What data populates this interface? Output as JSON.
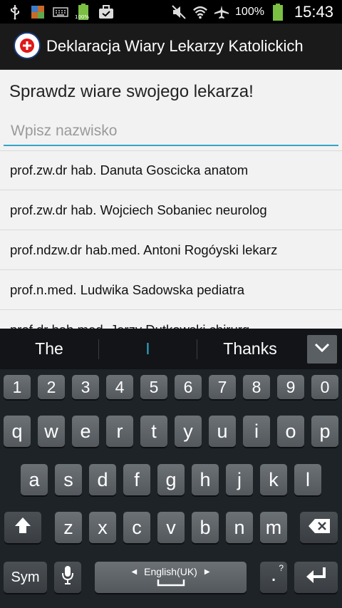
{
  "status_bar": {
    "left_icons": [
      "usb-icon",
      "image-icon",
      "keyboard-icon",
      "battery-full-icon",
      "briefcase-icon"
    ],
    "battery_badge": "100%",
    "battery_percent": "100%",
    "time": "15:43"
  },
  "app": {
    "title": "Deklaracja Wiary Lekarzy Katolickich"
  },
  "main": {
    "heading": "Sprawdz wiare swojego lekarza!",
    "search_placeholder": "Wpisz nazwisko",
    "search_value": "",
    "results": [
      "prof.zw.dr hab. Danuta Goscicka anatom",
      "prof.zw.dr hab. Wojciech Sobaniec neurolog",
      "prof.ndzw.dr hab.med. Antoni Rogóyski lekarz",
      "prof.n.med. Ludwika Sadowska pediatra",
      "prof.dr hab.med. Jerzy Dutkowski chirurg"
    ]
  },
  "keyboard": {
    "suggestions": [
      "The",
      "I",
      "Thanks"
    ],
    "number_row": [
      "1",
      "2",
      "3",
      "4",
      "5",
      "6",
      "7",
      "8",
      "9",
      "0"
    ],
    "row1": [
      "q",
      "w",
      "e",
      "r",
      "t",
      "y",
      "u",
      "i",
      "o",
      "p"
    ],
    "row2": [
      "a",
      "s",
      "d",
      "f",
      "g",
      "h",
      "j",
      "k",
      "l"
    ],
    "row3": [
      "z",
      "x",
      "c",
      "v",
      "b",
      "n",
      "m"
    ],
    "sym_label": "Sym",
    "space_label": "English(UK)",
    "period_label": ".",
    "period_hint": "?",
    "accent_color": "#33a5c7"
  }
}
